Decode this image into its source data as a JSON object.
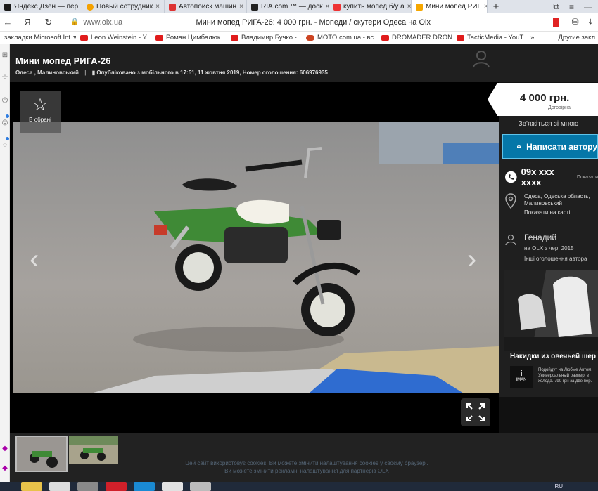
{
  "browser": {
    "tabs": [
      {
        "label": "Яндекс Дзен — пер",
        "color": "#1a1a1a"
      },
      {
        "label": "Новый сотрудник",
        "color": "#f4a100"
      },
      {
        "label": "Автопоиск машин",
        "color": "#d33"
      },
      {
        "label": "RIA.com ™ — доск",
        "color": "#222"
      },
      {
        "label": "купить мопед б/у а",
        "color": "#e33"
      },
      {
        "label": "Мини мопед РИГ",
        "color": "#f6a700",
        "active": true
      }
    ],
    "url": "www.olx.ua",
    "page_title": "Мини мопед РИГА-26: 4 000 грн. - Мопеди / скутери Одеса на Olx",
    "bookmarks": [
      {
        "label": "закладки Microsoft Int",
        "type": "folder"
      },
      {
        "label": "Leon Weinstein - Y",
        "type": "yt"
      },
      {
        "label": "Роман Цимбалюк",
        "type": "yt"
      },
      {
        "label": "Владимир Бучко -",
        "type": "yt"
      },
      {
        "label": "MOTO.com.ua - вс",
        "type": "moto"
      },
      {
        "label": "DROMADER DRON",
        "type": "yt"
      },
      {
        "label": "TacticMedia - YouT",
        "type": "yt"
      }
    ],
    "other_bookmarks": "Другие закл"
  },
  "listing": {
    "title": "Мини мопед РИГА-26",
    "location": "Одеса , Малиновський",
    "meta": "Опубліковано з мобільного в 17:51, 11 жовтня 2019, Номер оголошення: 606976935",
    "favorite_label": "В обрані",
    "price": "4 000 грн.",
    "negotiable": "Договірна"
  },
  "contact": {
    "header": "Зв'яжіться зі мною",
    "message_button": "Написати автору",
    "phone": "09x xxx xxxx",
    "phone_show": "Показати",
    "address": "Одеса, Одеська область, Малиновський",
    "map_link": "Показати на карті",
    "seller_name": "Генадий",
    "seller_since": "на OLX з чер. 2015",
    "seller_other": "Інші оголошення автора"
  },
  "ad": {
    "title": "Накидки из овечьей шер",
    "brand": "IMAN",
    "desc": "Подойдут на Любые Автом. Универсальный размер, з холода. 790 грн за две пер."
  },
  "footer": {
    "cookie_line1": "Цей сайт використовує cookies. Ви можете змінити налаштування cookies у своєму браузері.",
    "cookie_line2": "Ви можете змінити рекламні налаштування для партнерів OLX"
  },
  "taskbar": {
    "lang": "RU"
  }
}
